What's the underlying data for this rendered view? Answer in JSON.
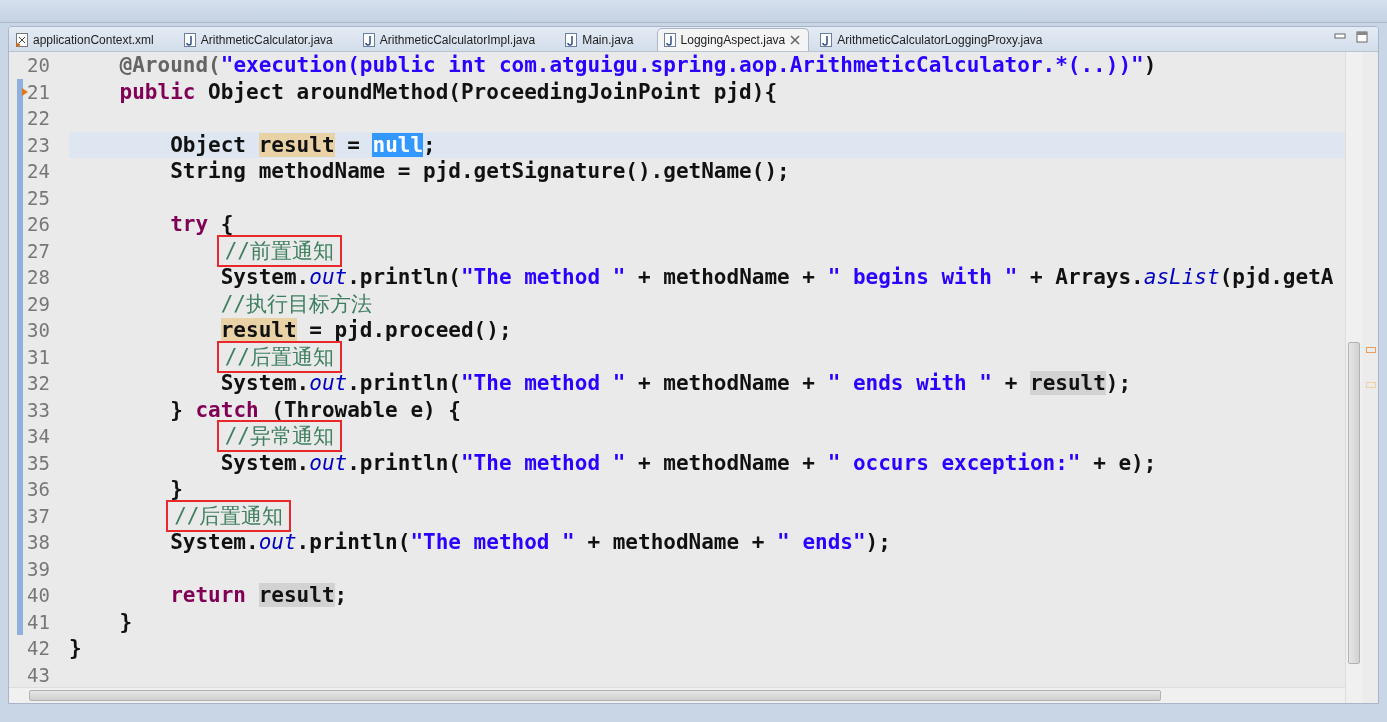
{
  "tabs": [
    {
      "label": "applicationContext.xml",
      "kind": "xml",
      "selected": false
    },
    {
      "label": "ArithmeticCalculator.java",
      "kind": "java",
      "selected": false
    },
    {
      "label": "ArithmeticCalculatorImpl.java",
      "kind": "java",
      "selected": false
    },
    {
      "label": "Main.java",
      "kind": "java",
      "selected": false
    },
    {
      "label": "LoggingAspect.java",
      "kind": "java",
      "selected": true
    },
    {
      "label": "ArithmeticCalculatorLoggingProxy.java",
      "kind": "java",
      "selected": false
    }
  ],
  "editor": {
    "lines": [
      {
        "number": "20",
        "current": false,
        "changed": false,
        "marker": false,
        "tokens": [
          {
            "kind": "ann",
            "text": "    @Around("
          },
          {
            "kind": "str",
            "text": "\"execution(public int com.atguigu.spring.aop.ArithmeticCalculator.*(..))\""
          },
          {
            "kind": "plain",
            "text": ")"
          }
        ]
      },
      {
        "number": "21",
        "current": false,
        "changed": true,
        "marker": true,
        "tokens": [
          {
            "kind": "kw",
            "text": "    public"
          },
          {
            "kind": "plain",
            "text": " Object aroundMethod(ProceedingJoinPoint pjd){"
          }
        ]
      },
      {
        "number": "22",
        "current": false,
        "changed": true,
        "marker": false
      },
      {
        "number": "23",
        "current": true,
        "changed": true,
        "marker": false,
        "tokens": [
          {
            "kind": "plain",
            "text": "        Object "
          },
          {
            "kind": "mark",
            "text": "result"
          },
          {
            "kind": "plain",
            "text": " = "
          },
          {
            "kind": "sel",
            "text": "null"
          },
          {
            "kind": "plain",
            "text": ";"
          }
        ]
      },
      {
        "number": "24",
        "current": false,
        "changed": true,
        "marker": false,
        "tokens": [
          {
            "kind": "plain",
            "text": "        String methodName = pjd.getSignature().getName();"
          }
        ]
      },
      {
        "number": "25",
        "current": false,
        "changed": true,
        "marker": false
      },
      {
        "number": "26",
        "current": false,
        "changed": true,
        "marker": false,
        "tokens": [
          {
            "kind": "kw",
            "text": "        try"
          },
          {
            "kind": "plain",
            "text": " {"
          }
        ]
      },
      {
        "number": "27",
        "current": false,
        "changed": true,
        "marker": false,
        "tokens": [
          {
            "kind": "comment",
            "text": "            //前置通知",
            "boxed": true
          }
        ]
      },
      {
        "number": "28",
        "current": false,
        "changed": true,
        "marker": false,
        "tokens": [
          {
            "kind": "plain",
            "text": "            System."
          },
          {
            "kind": "italic",
            "text": "out"
          },
          {
            "kind": "plain",
            "text": ".println("
          },
          {
            "kind": "str",
            "text": "\"The method \""
          },
          {
            "kind": "plain",
            "text": " + methodName + "
          },
          {
            "kind": "str",
            "text": "\" begins with \""
          },
          {
            "kind": "plain",
            "text": " + Arrays."
          },
          {
            "kind": "italic",
            "text": "asList"
          },
          {
            "kind": "plain",
            "text": "(pjd.getA"
          }
        ]
      },
      {
        "number": "29",
        "current": false,
        "changed": true,
        "marker": false,
        "tokens": [
          {
            "kind": "comment",
            "text": "            //执行目标方法",
            "boxed": false
          }
        ]
      },
      {
        "number": "30",
        "current": false,
        "changed": true,
        "marker": false,
        "tokens": [
          {
            "kind": "mark",
            "text": "            result"
          },
          {
            "kind": "plain",
            "text": " = pjd.proceed();"
          }
        ]
      },
      {
        "number": "31",
        "current": false,
        "changed": true,
        "marker": false,
        "tokens": [
          {
            "kind": "comment",
            "text": "            //后置通知",
            "boxed": true
          }
        ]
      },
      {
        "number": "32",
        "current": false,
        "changed": true,
        "marker": false,
        "tokens": [
          {
            "kind": "plain",
            "text": "            System."
          },
          {
            "kind": "italic",
            "text": "out"
          },
          {
            "kind": "plain",
            "text": ".println("
          },
          {
            "kind": "str",
            "text": "\"The method \""
          },
          {
            "kind": "plain",
            "text": " + methodName + "
          },
          {
            "kind": "str",
            "text": "\" ends with \""
          },
          {
            "kind": "plain",
            "text": " + "
          },
          {
            "kind": "occ",
            "text": "result"
          },
          {
            "kind": "plain",
            "text": ");"
          }
        ]
      },
      {
        "number": "33",
        "current": false,
        "changed": true,
        "marker": false,
        "tokens": [
          {
            "kind": "plain",
            "text": "        } "
          },
          {
            "kind": "kw",
            "text": "catch"
          },
          {
            "kind": "plain",
            "text": " (Throwable e) {"
          }
        ]
      },
      {
        "number": "34",
        "current": false,
        "changed": true,
        "marker": false,
        "tokens": [
          {
            "kind": "comment",
            "text": "            //异常通知",
            "boxed": true
          }
        ]
      },
      {
        "number": "35",
        "current": false,
        "changed": true,
        "marker": false,
        "tokens": [
          {
            "kind": "plain",
            "text": "            System."
          },
          {
            "kind": "italic",
            "text": "out"
          },
          {
            "kind": "plain",
            "text": ".println("
          },
          {
            "kind": "str",
            "text": "\"The method \""
          },
          {
            "kind": "plain",
            "text": " + methodName + "
          },
          {
            "kind": "str",
            "text": "\" occurs exception:\""
          },
          {
            "kind": "plain",
            "text": " + e);"
          }
        ]
      },
      {
        "number": "36",
        "current": false,
        "changed": true,
        "marker": false,
        "tokens": [
          {
            "kind": "plain",
            "text": "        }"
          }
        ]
      },
      {
        "number": "37",
        "current": false,
        "changed": true,
        "marker": false,
        "tokens": [
          {
            "kind": "comment",
            "text": "        //后置通知",
            "boxed": true
          }
        ]
      },
      {
        "number": "38",
        "current": false,
        "changed": true,
        "marker": false,
        "tokens": [
          {
            "kind": "plain",
            "text": "        System."
          },
          {
            "kind": "italic",
            "text": "out"
          },
          {
            "kind": "plain",
            "text": ".println("
          },
          {
            "kind": "str",
            "text": "\"The method \""
          },
          {
            "kind": "plain",
            "text": " + methodName + "
          },
          {
            "kind": "str",
            "text": "\" ends\""
          },
          {
            "kind": "plain",
            "text": ");"
          }
        ]
      },
      {
        "number": "39",
        "current": false,
        "changed": true,
        "marker": false
      },
      {
        "number": "40",
        "current": false,
        "changed": true,
        "marker": false,
        "tokens": [
          {
            "kind": "kw",
            "text": "        return"
          },
          {
            "kind": "occ",
            "text": " result"
          },
          {
            "kind": "plain",
            "text": ";"
          }
        ]
      },
      {
        "number": "41",
        "current": false,
        "changed": true,
        "marker": false,
        "tokens": [
          {
            "kind": "plain",
            "text": "    }"
          }
        ]
      },
      {
        "number": "42",
        "current": false,
        "changed": false,
        "marker": false,
        "tokens": [
          {
            "kind": "plain",
            "text": "}"
          }
        ]
      },
      {
        "number": "43",
        "current": false,
        "changed": false,
        "marker": false
      }
    ]
  }
}
